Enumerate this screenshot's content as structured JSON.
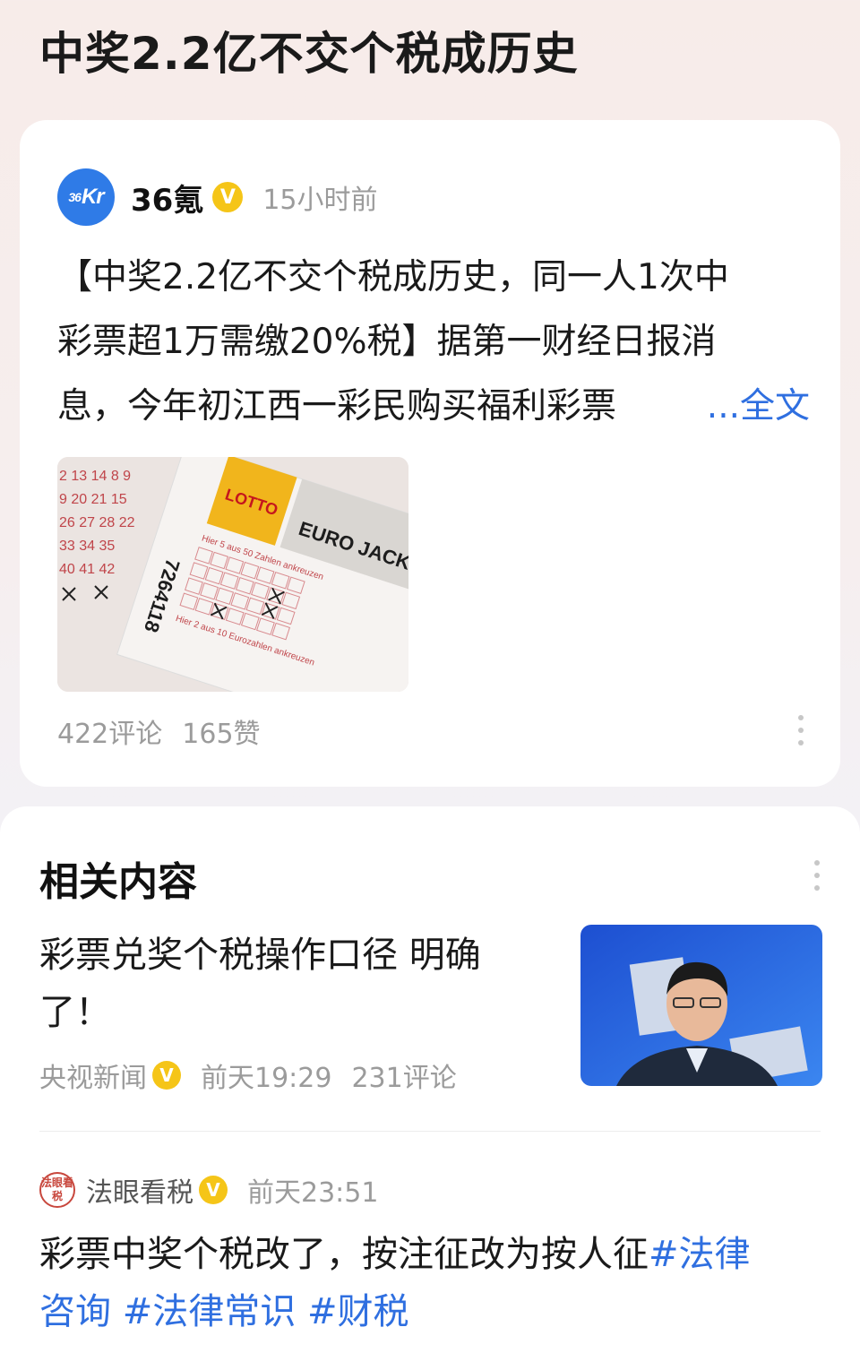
{
  "page": {
    "title": "中奖2.2亿不交个税成历史"
  },
  "post": {
    "author": "36氪",
    "avatar_text": "Kr",
    "avatar_sup": "36",
    "verified_mark": "V",
    "time": "15小时前",
    "text_lines": [
      "【中奖2.2亿不交个税成历史，同一人1次中",
      "彩票超1万需缴20%税】据第一财经日报消",
      "息，今年初江西一彩民购买福利彩票"
    ],
    "more_label": "...全文",
    "comments": "422评论",
    "likes": "165赞",
    "image": {
      "numbers_left": [
        "2 13 14 8 9",
        "9 20 21 15",
        "26 27 28 22",
        "33 34 35",
        "40 41 42"
      ],
      "ticket_serial": "7264118",
      "lotto_label": "LOTTO",
      "jackpot_label": "EURO JACKPOT",
      "hier_label": "Hier 5 aus 50 Zahlen ankreuzen",
      "hier2_label": "Hier 2 aus 10 Eurozahlen ankreuzen"
    }
  },
  "related": {
    "title": "相关内容",
    "items": [
      {
        "title_line1": "彩票兑奖个税操作口径 明确",
        "title_line2": "了！",
        "source": "央视新闻",
        "time": "前天19:29",
        "comments": "231评论"
      },
      {
        "author": "法眼看税",
        "seal_text": "法眼看税",
        "time": "前天23:51",
        "text": "彩票中奖个税改了，按注征改为按人征",
        "tags": [
          "#法律",
          "咨询",
          "#法律常识",
          "#财税"
        ]
      }
    ]
  },
  "colors": {
    "accent": "#2f6fe0",
    "verified": "#f5c518",
    "avatar": "#2f7be7",
    "muted": "#9b9b9b"
  }
}
